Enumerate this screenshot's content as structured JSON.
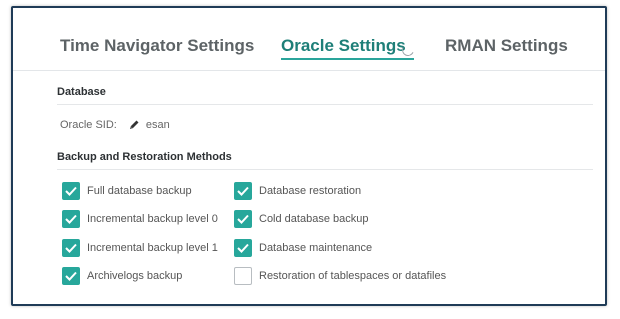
{
  "tabs": [
    {
      "label": "Time Navigator Settings",
      "active": false
    },
    {
      "label": "Oracle Settings",
      "active": true
    },
    {
      "label": "RMAN Settings",
      "active": false
    }
  ],
  "database": {
    "section_title": "Database",
    "sid_label": "Oracle SID:",
    "sid_value": "esan"
  },
  "methods": {
    "section_title": "Backup and Restoration Methods",
    "items": [
      {
        "label": "Full database backup",
        "checked": true
      },
      {
        "label": "Incremental backup level 0",
        "checked": true
      },
      {
        "label": "Incremental backup level 1",
        "checked": true
      },
      {
        "label": "Archivelogs backup",
        "checked": true
      },
      {
        "label": "Database restoration",
        "checked": true
      },
      {
        "label": "Cold database backup",
        "checked": true
      },
      {
        "label": "Database maintenance",
        "checked": true
      },
      {
        "label": "Restoration of tablespaces or datafiles",
        "checked": false
      }
    ]
  },
  "colors": {
    "accent": "#27a79b",
    "active_tab": "#1e7f78",
    "frame_border": "#1f3b57"
  }
}
